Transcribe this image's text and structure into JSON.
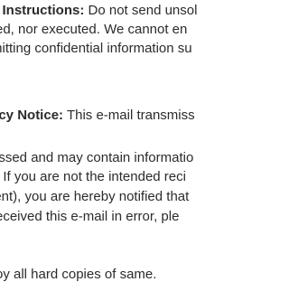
{
  "instructions": {
    "heading": "e Instructions:",
    "lines": [
      " Do not send unsol",
      "red, nor executed. We cannot en",
      "mitting confidential information su"
    ]
  },
  "privacy": {
    "heading": "acy Notice:",
    "lines": [
      " This e-mail transmiss",
      "essed and may contain informatio",
      "). If you are not the intended reci",
      "ient), you are hereby notified that",
      " received this e-mail in error, ple",
      "roy all hard copies of same."
    ]
  }
}
